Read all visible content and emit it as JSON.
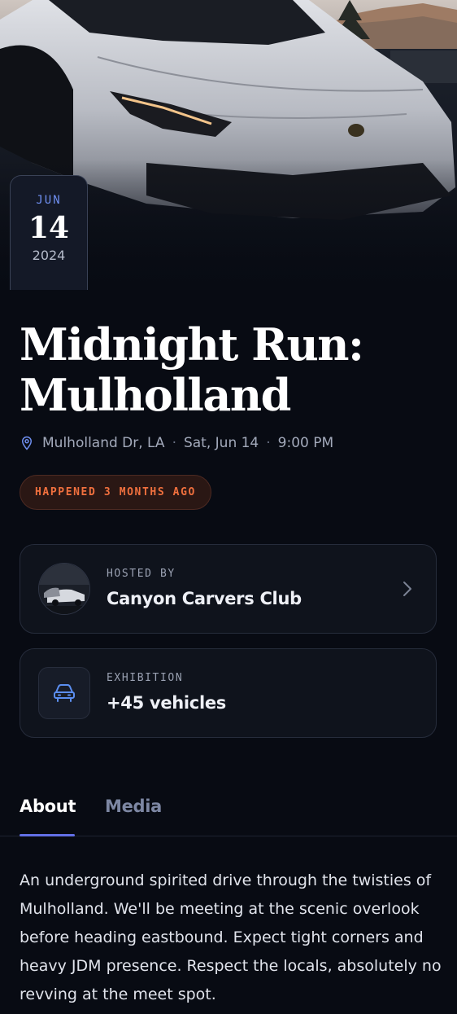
{
  "event": {
    "date": {
      "month": "JUN",
      "day": "14",
      "year": "2024"
    },
    "title": "Midnight Run: Mulholland",
    "meta": {
      "location": "Mulholland Dr, LA",
      "day": "Sat, Jun 14",
      "time": "9:00 PM",
      "separator": "·",
      "location_icon": "map-pin-icon"
    },
    "status": "HAPPENED 3 MONTHS AGO"
  },
  "host_card": {
    "label": "HOSTED BY",
    "name": "Canyon Carvers Club",
    "chevron_icon": "chevron-right-icon"
  },
  "exhibition_card": {
    "label": "EXHIBITION",
    "value": "+45 vehicles",
    "icon": "car-icon"
  },
  "tabs": {
    "about": "About",
    "media": "Media",
    "active": "About"
  },
  "about_text": "An underground spirited drive through the twisties of Mulholland. We'll be meeting at the scenic overlook before heading eastbound. Expect tight corners and heavy JDM presence. Respect the locals, absolutely no revving at the meet spot.",
  "colors": {
    "background": "#080b13",
    "accent": "#6270e6",
    "status": "#f0703e",
    "month": "#6f8ff0"
  }
}
